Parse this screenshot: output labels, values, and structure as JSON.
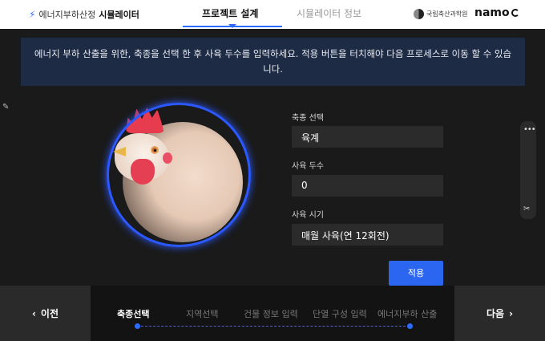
{
  "header": {
    "brand_prefix": "에너지부하산정",
    "brand_name": "시뮬레이터",
    "tabs": [
      {
        "label": "프로젝트 설계",
        "active": true
      },
      {
        "label": "시뮬레이터 정보",
        "active": false
      }
    ],
    "org_logo_text": "국립축산과학원",
    "namo_logo_text": "namo",
    "accent_color": "#2d6bff"
  },
  "notice": {
    "text": "에너지 부하 산출을 위한, 축종을 선택 한 후 사육 두수를 입력하세요. 적용 버튼을 터치해야 다음 프로세스로 이동 할 수 있습니다."
  },
  "form": {
    "species_label": "축종 선택",
    "species_value": "육계",
    "count_label": "사육 두수",
    "count_value": "0",
    "period_label": "사육 시기",
    "period_value": "매월 사육(연 12회전)",
    "apply_label": "적용"
  },
  "nav": {
    "prev_label": "이전",
    "next_label": "다음",
    "steps": [
      {
        "label": "축종선택",
        "active": true
      },
      {
        "label": "지역선택",
        "active": false
      },
      {
        "label": "건물 정보 입력",
        "active": false
      },
      {
        "label": "단열 구성 입력",
        "active": false
      },
      {
        "label": "에너지부하 산출",
        "active": false
      }
    ]
  }
}
